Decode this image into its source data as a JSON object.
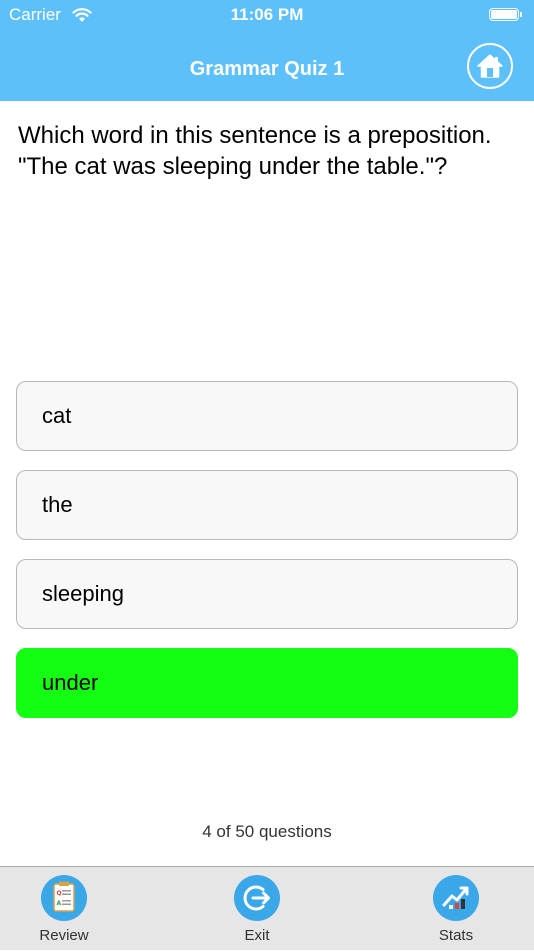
{
  "status_bar": {
    "carrier": "Carrier",
    "time": "11:06 PM"
  },
  "header": {
    "title": "Grammar Quiz 1",
    "home_icon": "home-icon"
  },
  "question": {
    "text": "Which word in this sentence is a preposition. \"The cat was sleeping under the table.\"?"
  },
  "answers": [
    {
      "label": "cat",
      "correct": false
    },
    {
      "label": "the",
      "correct": false
    },
    {
      "label": "sleeping",
      "correct": false
    },
    {
      "label": "under",
      "correct": true
    }
  ],
  "progress": {
    "text": "4 of 50 questions"
  },
  "tabbar": {
    "items": [
      {
        "label": "Review",
        "icon": "clipboard-icon"
      },
      {
        "label": "Exit",
        "icon": "exit-icon"
      },
      {
        "label": "Stats",
        "icon": "stats-chart-icon"
      }
    ]
  },
  "colors": {
    "header": "#5dc0fb",
    "correct": "#13fe13",
    "tab_icon": "#3aa7e8"
  }
}
